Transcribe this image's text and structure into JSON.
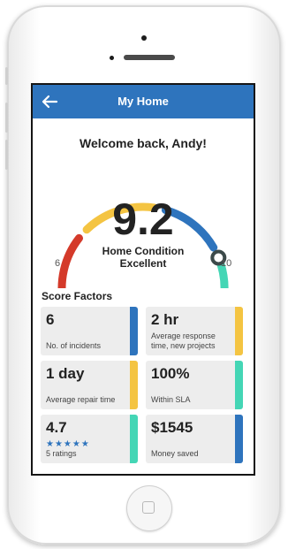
{
  "header": {
    "title": "My Home",
    "back_icon": "arrow-left-icon"
  },
  "welcome": "Welcome back, Andy!",
  "gauge": {
    "score": "9.2",
    "condition_line1": "Home Condition",
    "condition_line2": "Excellent",
    "min_label": "6",
    "max_label": "10",
    "colors": [
      "#d43a2a",
      "#f4c442",
      "#2e74bd",
      "#44d6b5"
    ]
  },
  "score_factors": {
    "title": "Score Factors",
    "cards": [
      {
        "value": "6",
        "label": "No. of incidents",
        "accent": "#2e74bd"
      },
      {
        "value": "2 hr",
        "label": "Average response time, new projects",
        "accent": "#f4c442"
      },
      {
        "value": "1 day",
        "label": "Average repair time",
        "accent": "#f4c442"
      },
      {
        "value": "100%",
        "label": "Within SLA",
        "accent": "#44d6b5"
      },
      {
        "value": "4.7",
        "label": "5 ratings",
        "accent": "#44d6b5",
        "stars": 5
      },
      {
        "value": "$1545",
        "label": "Money saved",
        "accent": "#2e74bd"
      }
    ]
  }
}
